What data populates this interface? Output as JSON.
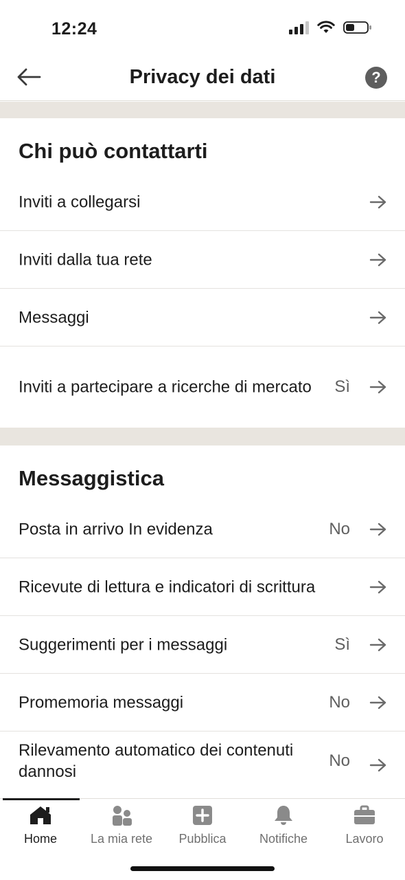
{
  "status_bar": {
    "time": "12:24"
  },
  "header": {
    "title": "Privacy dei dati",
    "help_label": "?"
  },
  "sections": [
    {
      "title": "Chi può contattarti",
      "rows": [
        {
          "label": "Inviti a collegarsi",
          "value": ""
        },
        {
          "label": "Inviti dalla tua rete",
          "value": ""
        },
        {
          "label": "Messaggi",
          "value": ""
        },
        {
          "label": "Inviti a partecipare a ricerche di mercato",
          "value": "Sì"
        }
      ]
    },
    {
      "title": "Messaggistica",
      "rows": [
        {
          "label": "Posta in arrivo In evidenza",
          "value": "No"
        },
        {
          "label": "Ricevute di lettura e indicatori di scrittura",
          "value": ""
        },
        {
          "label": "Suggerimenti per i messaggi",
          "value": "Sì"
        },
        {
          "label": "Promemoria messaggi",
          "value": "No"
        },
        {
          "label": "Rilevamento automatico dei contenuti dannosi",
          "value": "No"
        }
      ]
    }
  ],
  "bottom_nav": {
    "items": [
      {
        "label": "Home",
        "icon": "home-icon",
        "active": true
      },
      {
        "label": "La mia rete",
        "icon": "network-icon",
        "active": false
      },
      {
        "label": "Pubblica",
        "icon": "post-icon",
        "active": false
      },
      {
        "label": "Notifiche",
        "icon": "bell-icon",
        "active": false
      },
      {
        "label": "Lavoro",
        "icon": "briefcase-icon",
        "active": false
      }
    ]
  },
  "colors": {
    "text": "#1d1d1d",
    "muted": "#5f5f5f",
    "band": "#e9e5df",
    "icon_gray": "#8a8a8a"
  }
}
